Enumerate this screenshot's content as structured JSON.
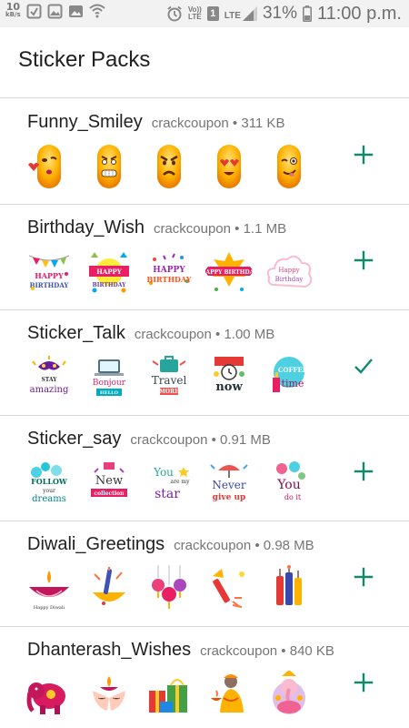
{
  "status_bar": {
    "net_speed": "10",
    "net_unit": "kB/s",
    "volte_top": "Vo))",
    "volte_bottom": "LTE",
    "sim": "1",
    "network_type": "LTE",
    "battery_percent": "31%",
    "clock": "11:00 p.m."
  },
  "app_bar": {
    "title": "Sticker Packs"
  },
  "colors": {
    "accent": "#0f8a6c",
    "divider": "#d8d8d8",
    "meta_text": "#757575"
  },
  "packs": [
    {
      "name": "Funny_Smiley",
      "meta": "crackcoupon • 311 KB",
      "action": "add",
      "stickers": [
        "kissing-face-sticker",
        "grimacing-face-sticker",
        "angry-face-sticker",
        "heart-eyes-face-sticker",
        "winking-face-sticker"
      ]
    },
    {
      "name": "Birthday_Wish",
      "meta": "crackcoupon • 1.1 MB",
      "action": "add",
      "stickers": [
        "happy-birthday-bunting-sticker",
        "happy-birthday-banner-sticker",
        "happy-birthday-confetti-sticker",
        "happy-birthday-ribbon-sticker",
        "happy-birthday-cloud-sticker"
      ]
    },
    {
      "name": "Sticker_Talk",
      "meta": "crackcoupon • 1.00 MB",
      "action": "added",
      "stickers": [
        "stay-amazing-sticker",
        "bonjour-laptop-sticker",
        "travel-more-sticker",
        "now-clock-sticker",
        "coffee-time-sticker"
      ]
    },
    {
      "name": "Sticker_say",
      "meta": "crackcoupon • 0.91 MB",
      "action": "add",
      "stickers": [
        "follow-your-dreams-sticker",
        "new-collection-sticker",
        "you-my-star-sticker",
        "never-give-up-sticker",
        "you-do-it-sticker"
      ]
    },
    {
      "name": "Diwali_Greetings",
      "meta": "crackcoupon • 0.98 MB",
      "action": "add",
      "stickers": [
        "happy-diwali-diya-sticker",
        "sparkler-bowl-sticker",
        "hanging-lanterns-sticker",
        "rocket-firecracker-sticker",
        "firecracker-bundle-sticker"
      ]
    },
    {
      "name": "Dhanterash_Wishes",
      "meta": "crackcoupon • 840 KB",
      "action": "add",
      "stickers": [
        "decorated-elephant-sticker",
        "hands-with-diya-sticker",
        "gift-boxes-sticker",
        "woman-with-lamp-sticker",
        "ganesha-sticker"
      ]
    }
  ]
}
